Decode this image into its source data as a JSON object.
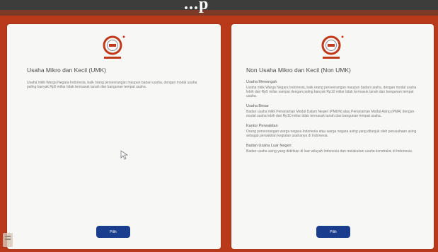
{
  "header": {
    "title": "...p"
  },
  "left_card": {
    "heading": "Usaha Mikro dan Kecil (UMK)",
    "description": "Usaha milik Warga Negara Indonesia, baik orang perseorangan maupun badan usaha, dengan modal usaha paling banyak Rp5 miliar tidak termasuk tanah dan bangunan tempat usaha.",
    "button_label": "Pilih"
  },
  "right_card": {
    "heading": "Non Usaha Mikro dan Kecil (Non UMK)",
    "sections": [
      {
        "title": "Usaha Menengah",
        "body": "Usaha milik Warga Negara Indonesia, baik orang perseorangan maupun badan usaha, dengan modal usaha lebih dari Rp5 miliar sampai dengan paling banyak Rp10 miliar tidak termasuk tanah dan bangunan tempat usaha."
      },
      {
        "title": "Usaha Besar",
        "body": "Badan usaha milik Penanaman Modal Dalam Negeri (PMDN) atau Penanaman Modal Asing (PMA) dengan modal usaha lebih dari Rp10 miliar tidak termasuk tanah dan bangunan tempat usaha."
      },
      {
        "title": "Kantor Perwakilan",
        "body": "Orang perseorangan warga negara Indonesia atau warga negara asing yang ditunjuk oleh perusahaan asing sebagai perwakilan kegiatan usahanya di Indonesia."
      },
      {
        "title": "Badan Usaha Luar Negeri",
        "body": "Badan usaha asing yang didirikan di luar wilayah Indonesia dan melakukan usaha konstruksi di Indonesia."
      }
    ],
    "button_label": "Pilih"
  }
}
